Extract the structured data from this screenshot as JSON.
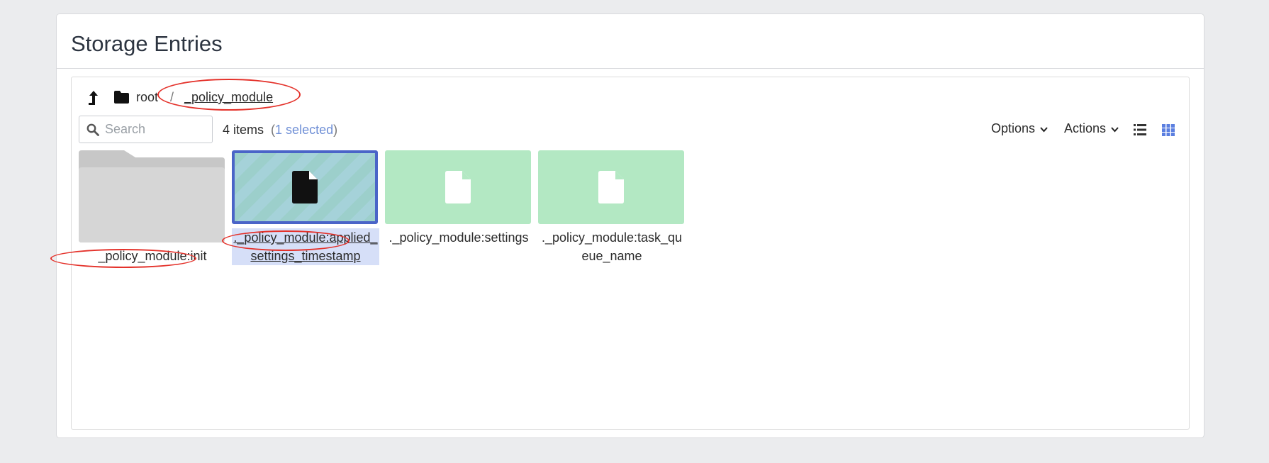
{
  "header": {
    "title": "Storage Entries"
  },
  "breadcrumb": {
    "root_label": "root",
    "separator": "/",
    "current": "_policy_module"
  },
  "toolbar": {
    "search_placeholder": "Search",
    "count_text": "4 items",
    "selected_text": "1 selected",
    "options_label": "Options",
    "actions_label": "Actions"
  },
  "items": [
    {
      "label": "_policy_module:init",
      "type": "folder",
      "icon": "folder-icon"
    },
    {
      "label": "._policy_module:applied_settings_timestamp",
      "type": "file",
      "selected": true,
      "icon": "file-icon"
    },
    {
      "label": "._policy_module:settings",
      "type": "file",
      "icon": "file-icon"
    },
    {
      "label": "._policy_module:task_queue_name",
      "type": "file",
      "icon": "file-icon"
    }
  ],
  "colors": {
    "selection_border": "#4a64c8",
    "file_tile": "#b3e8c3",
    "folder_tile": "#d4d4d4",
    "annotation": "#e4322b",
    "accent": "#6f8fd6"
  }
}
